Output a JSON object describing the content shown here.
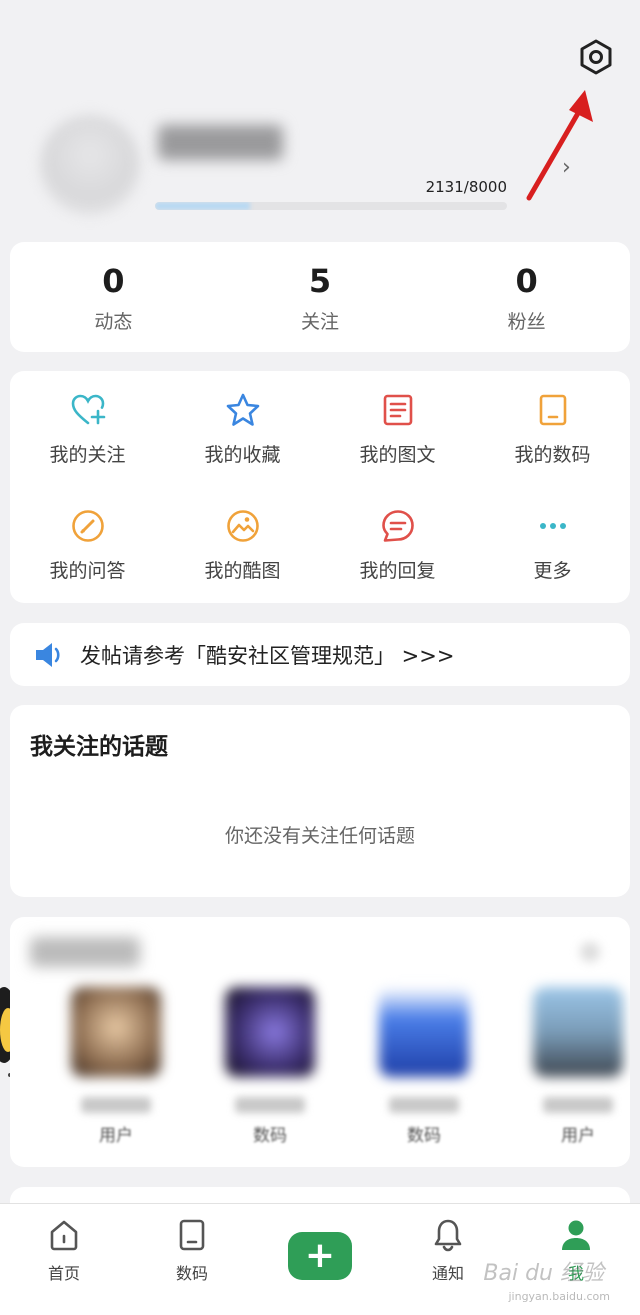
{
  "header": {
    "level_progress_text": "2131/8000",
    "level_progress_fraction": 0.266,
    "settings_icon": "hexagon-gear-icon",
    "annotation": "red-arrow-pointing-to-settings"
  },
  "stats": [
    {
      "value": "0",
      "label": "动态"
    },
    {
      "value": "5",
      "label": "关注"
    },
    {
      "value": "0",
      "label": "粉丝"
    }
  ],
  "shortcuts": [
    {
      "label": "我的关注",
      "icon": "heart-plus-icon",
      "color": "#3bb6c8"
    },
    {
      "label": "我的收藏",
      "icon": "star-icon",
      "color": "#3a86e0"
    },
    {
      "label": "我的图文",
      "icon": "document-icon",
      "color": "#e0504a"
    },
    {
      "label": "我的数码",
      "icon": "tablet-icon",
      "color": "#f0a23a"
    },
    {
      "label": "我的问答",
      "icon": "pencil-icon",
      "color": "#f0a23a"
    },
    {
      "label": "我的酷图",
      "icon": "picture-icon",
      "color": "#f0a23a"
    },
    {
      "label": "我的回复",
      "icon": "chat-icon",
      "color": "#e0504a"
    },
    {
      "label": "更多",
      "icon": "more-dots-icon",
      "color": "#3bb6c8"
    }
  ],
  "notice": {
    "text": "发帖请参考「酷安社区管理规范」 >>>",
    "icon": "speaker-icon",
    "icon_color": "#3a86e0"
  },
  "topics": {
    "title": "我关注的话题",
    "empty_text": "你还没有关注任何话题"
  },
  "recent": {
    "items": [
      {
        "category": "用户"
      },
      {
        "category": "数码"
      },
      {
        "category": "数码"
      },
      {
        "category": "用户"
      }
    ]
  },
  "bottom_nav": [
    {
      "label": "首页",
      "icon": "home-icon"
    },
    {
      "label": "数码",
      "icon": "tablet-icon"
    },
    {
      "label": "",
      "icon": "plus-icon"
    },
    {
      "label": "通知",
      "icon": "bell-icon"
    },
    {
      "label": "我",
      "icon": "person-icon",
      "active": true
    }
  ],
  "colors": {
    "accent": "#2f9e57",
    "background": "#f1f1f3"
  },
  "watermark": {
    "text": "Bai du 经验",
    "sub": "jingyan.baidu.com"
  }
}
